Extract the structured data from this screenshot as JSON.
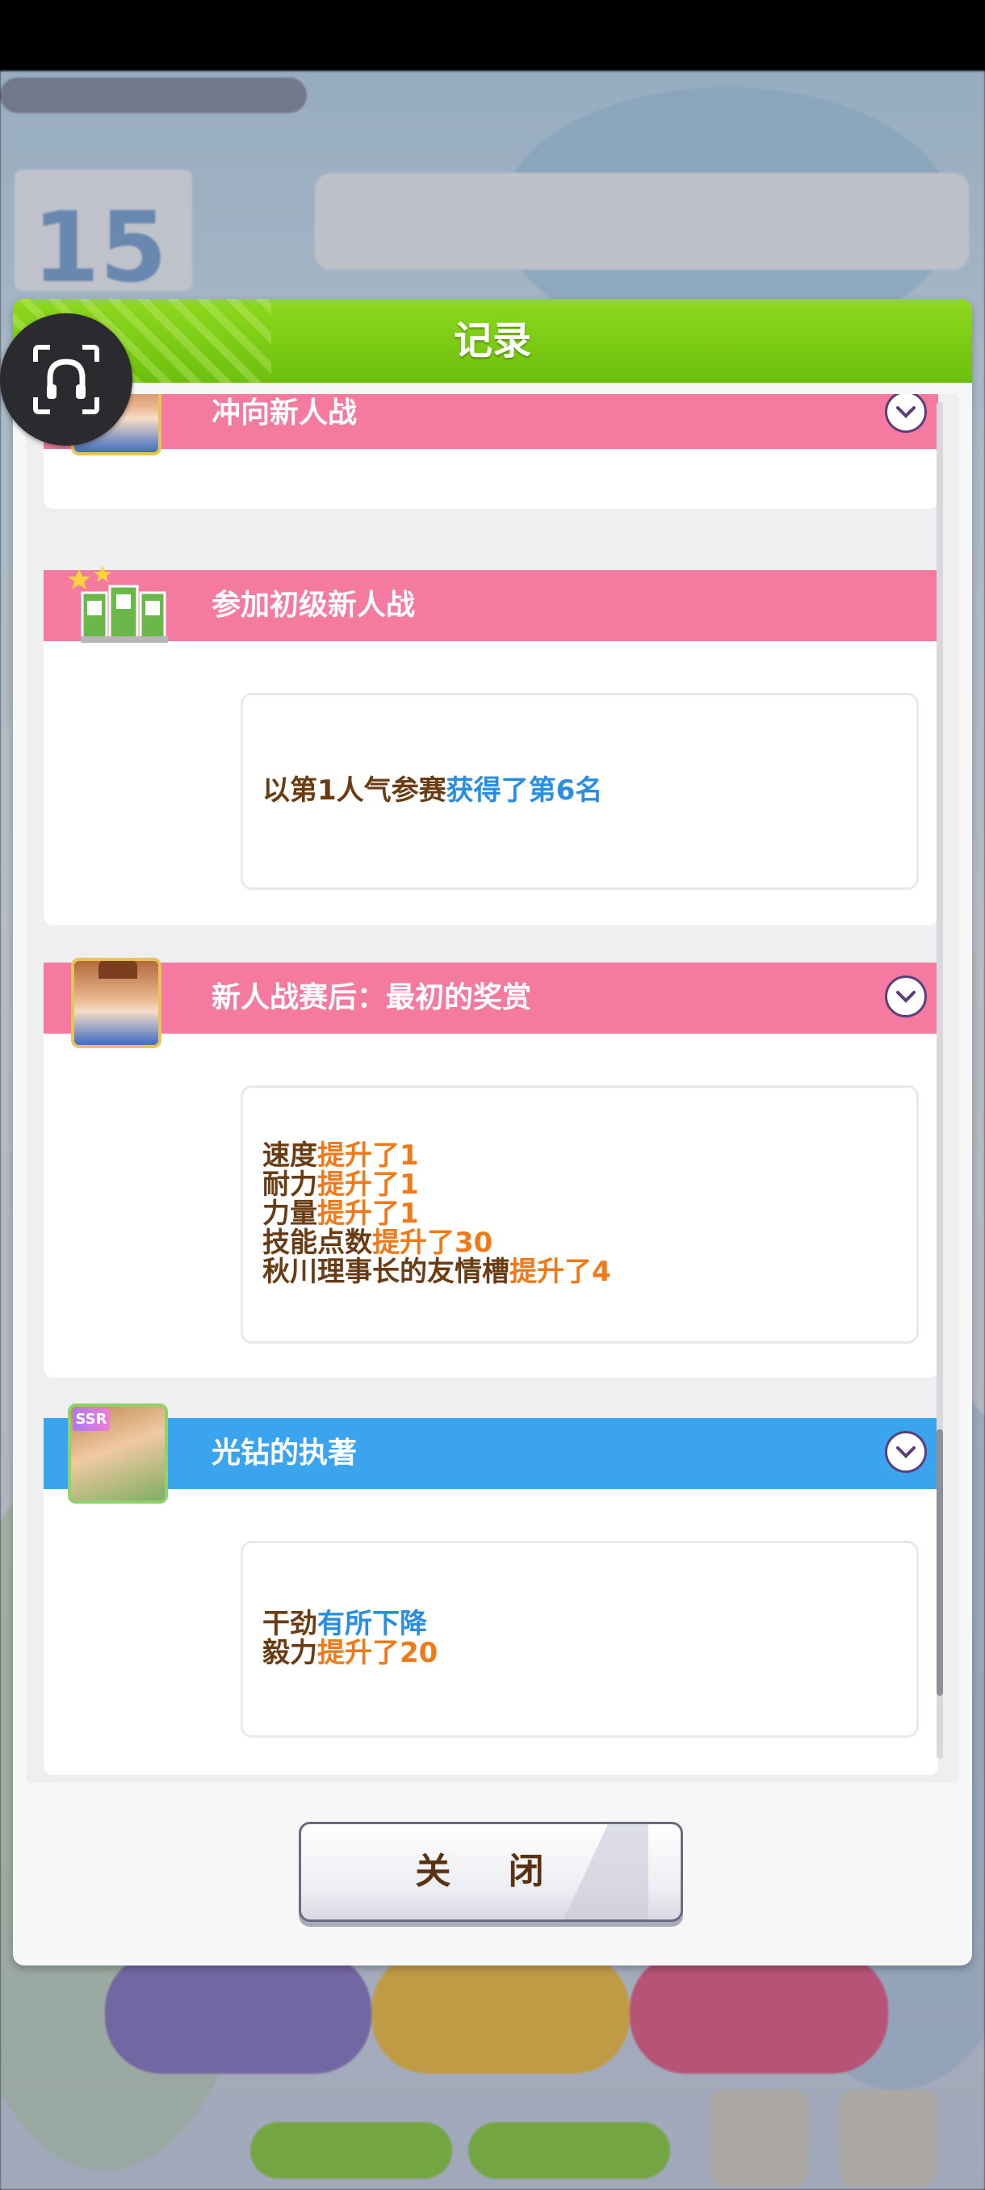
{
  "dialog": {
    "title": "记录",
    "close_label": "关 闭"
  },
  "entries": [
    {
      "title": "冲向新人战",
      "style": "pink",
      "icon": "character-portrait-icon",
      "expand_icon": "chevron-down-icon",
      "lines": []
    },
    {
      "title": "参加初级新人战",
      "style": "pink",
      "icon": "race-podium-icon",
      "lines": [
        [
          {
            "text": "以第1人气参赛",
            "color": "brown"
          },
          {
            "text": "获得了第6名",
            "color": "blue"
          }
        ]
      ]
    },
    {
      "title": "新人战赛后：最初的奖赏",
      "style": "pink",
      "icon": "character-portrait-icon",
      "expand_icon": "chevron-down-icon",
      "lines": [
        [
          {
            "text": "速度",
            "color": "brown"
          },
          {
            "text": "提升了1",
            "color": "orange"
          }
        ],
        [
          {
            "text": "耐力",
            "color": "brown"
          },
          {
            "text": "提升了1",
            "color": "orange"
          }
        ],
        [
          {
            "text": "力量",
            "color": "brown"
          },
          {
            "text": "提升了1",
            "color": "orange"
          }
        ],
        [
          {
            "text": "技能点数",
            "color": "brown"
          },
          {
            "text": "提升了30",
            "color": "orange"
          }
        ],
        [
          {
            "text": "秋川理事长的友情槽",
            "color": "brown"
          },
          {
            "text": "提升了4",
            "color": "orange"
          }
        ]
      ]
    },
    {
      "title": "光钻的执著",
      "style": "blue",
      "icon": "ssr-support-card-icon",
      "badge": "SSR",
      "expand_icon": "chevron-down-icon",
      "lines": [
        [
          {
            "text": "干劲",
            "color": "brown"
          },
          {
            "text": "有所下降",
            "color": "blue"
          }
        ],
        [
          {
            "text": "毅力",
            "color": "brown"
          },
          {
            "text": "提升了20",
            "color": "orange"
          }
        ]
      ]
    }
  ],
  "background": {
    "turn_number": "15"
  },
  "colors": {
    "header_green": "#7ccb14",
    "entry_pink": "#f47aa0",
    "entry_blue": "#3aa4ee",
    "text_brown": "#6a3c14",
    "text_blue": "#2a8ee0",
    "text_orange": "#f07a1a"
  }
}
